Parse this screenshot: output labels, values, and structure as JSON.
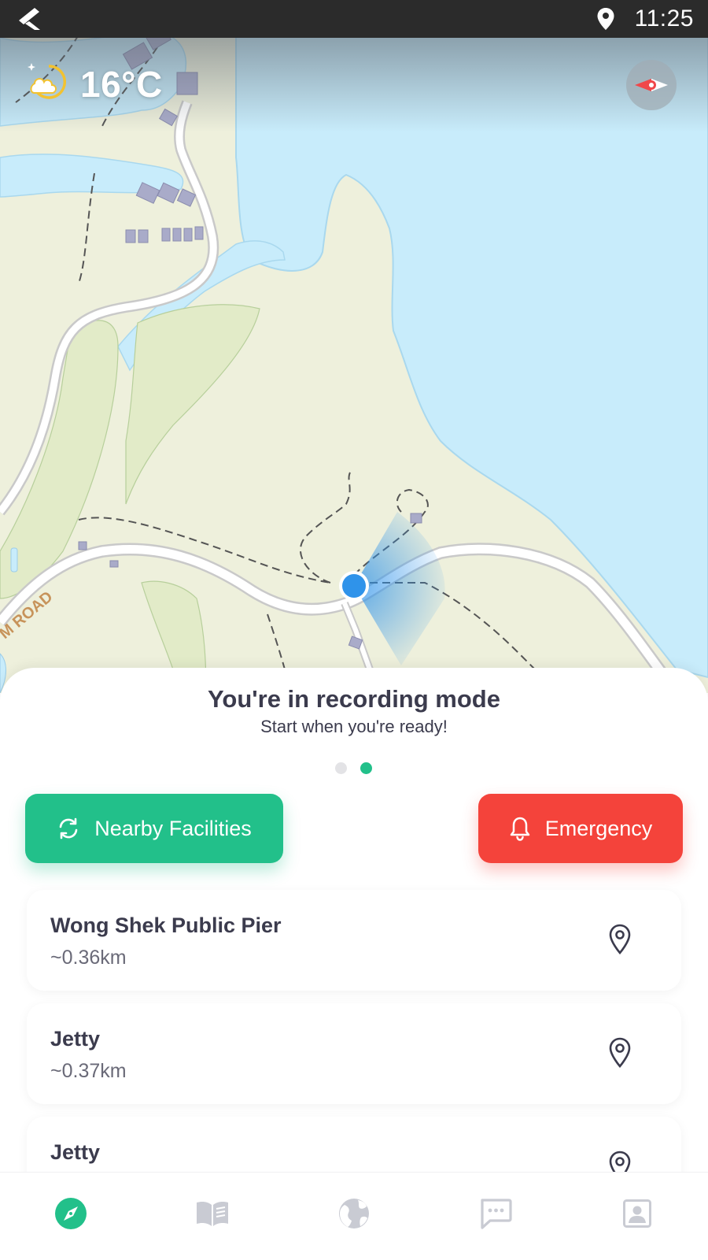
{
  "status_bar": {
    "time": "11:25",
    "app_icon": "flutter-icon",
    "location_icon": "location-pin-icon"
  },
  "weather": {
    "temperature": "16°C",
    "icon": "partly-cloudy-night-icon"
  },
  "map": {
    "road_label": "M ROAD",
    "colors": {
      "land": "#eef0dc",
      "water": "#c8ecfb",
      "road": "#ffffff",
      "vegetation": "#b7cf9b",
      "user_location": "#2f93ea"
    }
  },
  "recording": {
    "title": "You're in recording mode",
    "subtitle": "Start when you're ready!",
    "pager_pages": 2,
    "pager_active": 2
  },
  "actions": {
    "nearby_label": "Nearby Facilities",
    "nearby_icon": "refresh-icon",
    "emergency_label": "Emergency",
    "emergency_icon": "bell-icon",
    "colors": {
      "nearby": "#22c08a",
      "emergency": "#f4433b"
    }
  },
  "facilities": [
    {
      "name": "Wong Shek Public Pier",
      "distance": "~0.36km"
    },
    {
      "name": "Jetty",
      "distance": "~0.37km"
    },
    {
      "name": "Jetty",
      "distance": ""
    }
  ],
  "nav": [
    {
      "icon": "compass-icon",
      "active": true
    },
    {
      "icon": "book-icon",
      "active": false
    },
    {
      "icon": "globe-icon",
      "active": false
    },
    {
      "icon": "chat-icon",
      "active": false
    },
    {
      "icon": "profile-icon",
      "active": false
    }
  ]
}
